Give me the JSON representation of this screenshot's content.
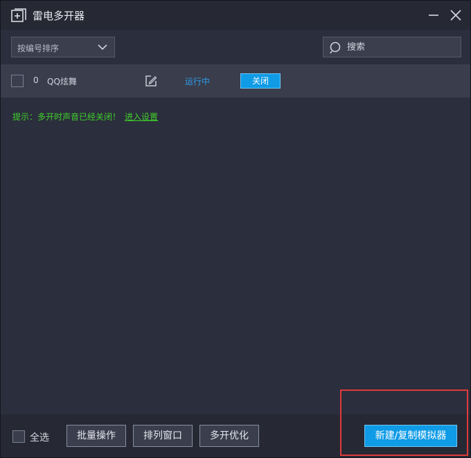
{
  "window": {
    "title": "雷电多开器",
    "icons": {
      "app": "add-square-icon",
      "minimize": "minimize-icon",
      "close": "close-icon"
    }
  },
  "toolbar": {
    "sort_label": "按编号排序",
    "sort_icon": "chevron-down-icon",
    "search_placeholder": "搜索",
    "search_icon": "search-icon"
  },
  "instances": [
    {
      "index": "0",
      "name": "QQ炫舞",
      "status": "运行中",
      "action": "关闭",
      "checked": false
    }
  ],
  "hint": {
    "text": "提示：多开时声音已经关闭！",
    "link": "进入设置"
  },
  "footer": {
    "select_all": "全选",
    "batch": "批量操作",
    "arrange": "排列窗口",
    "optimize": "多开优化",
    "new_vm": "新建/复制模拟器"
  },
  "colors": {
    "accent": "#0f9be6",
    "status": "#2f9be8",
    "hint": "#3fd12a",
    "highlight": "#e03a3a"
  }
}
